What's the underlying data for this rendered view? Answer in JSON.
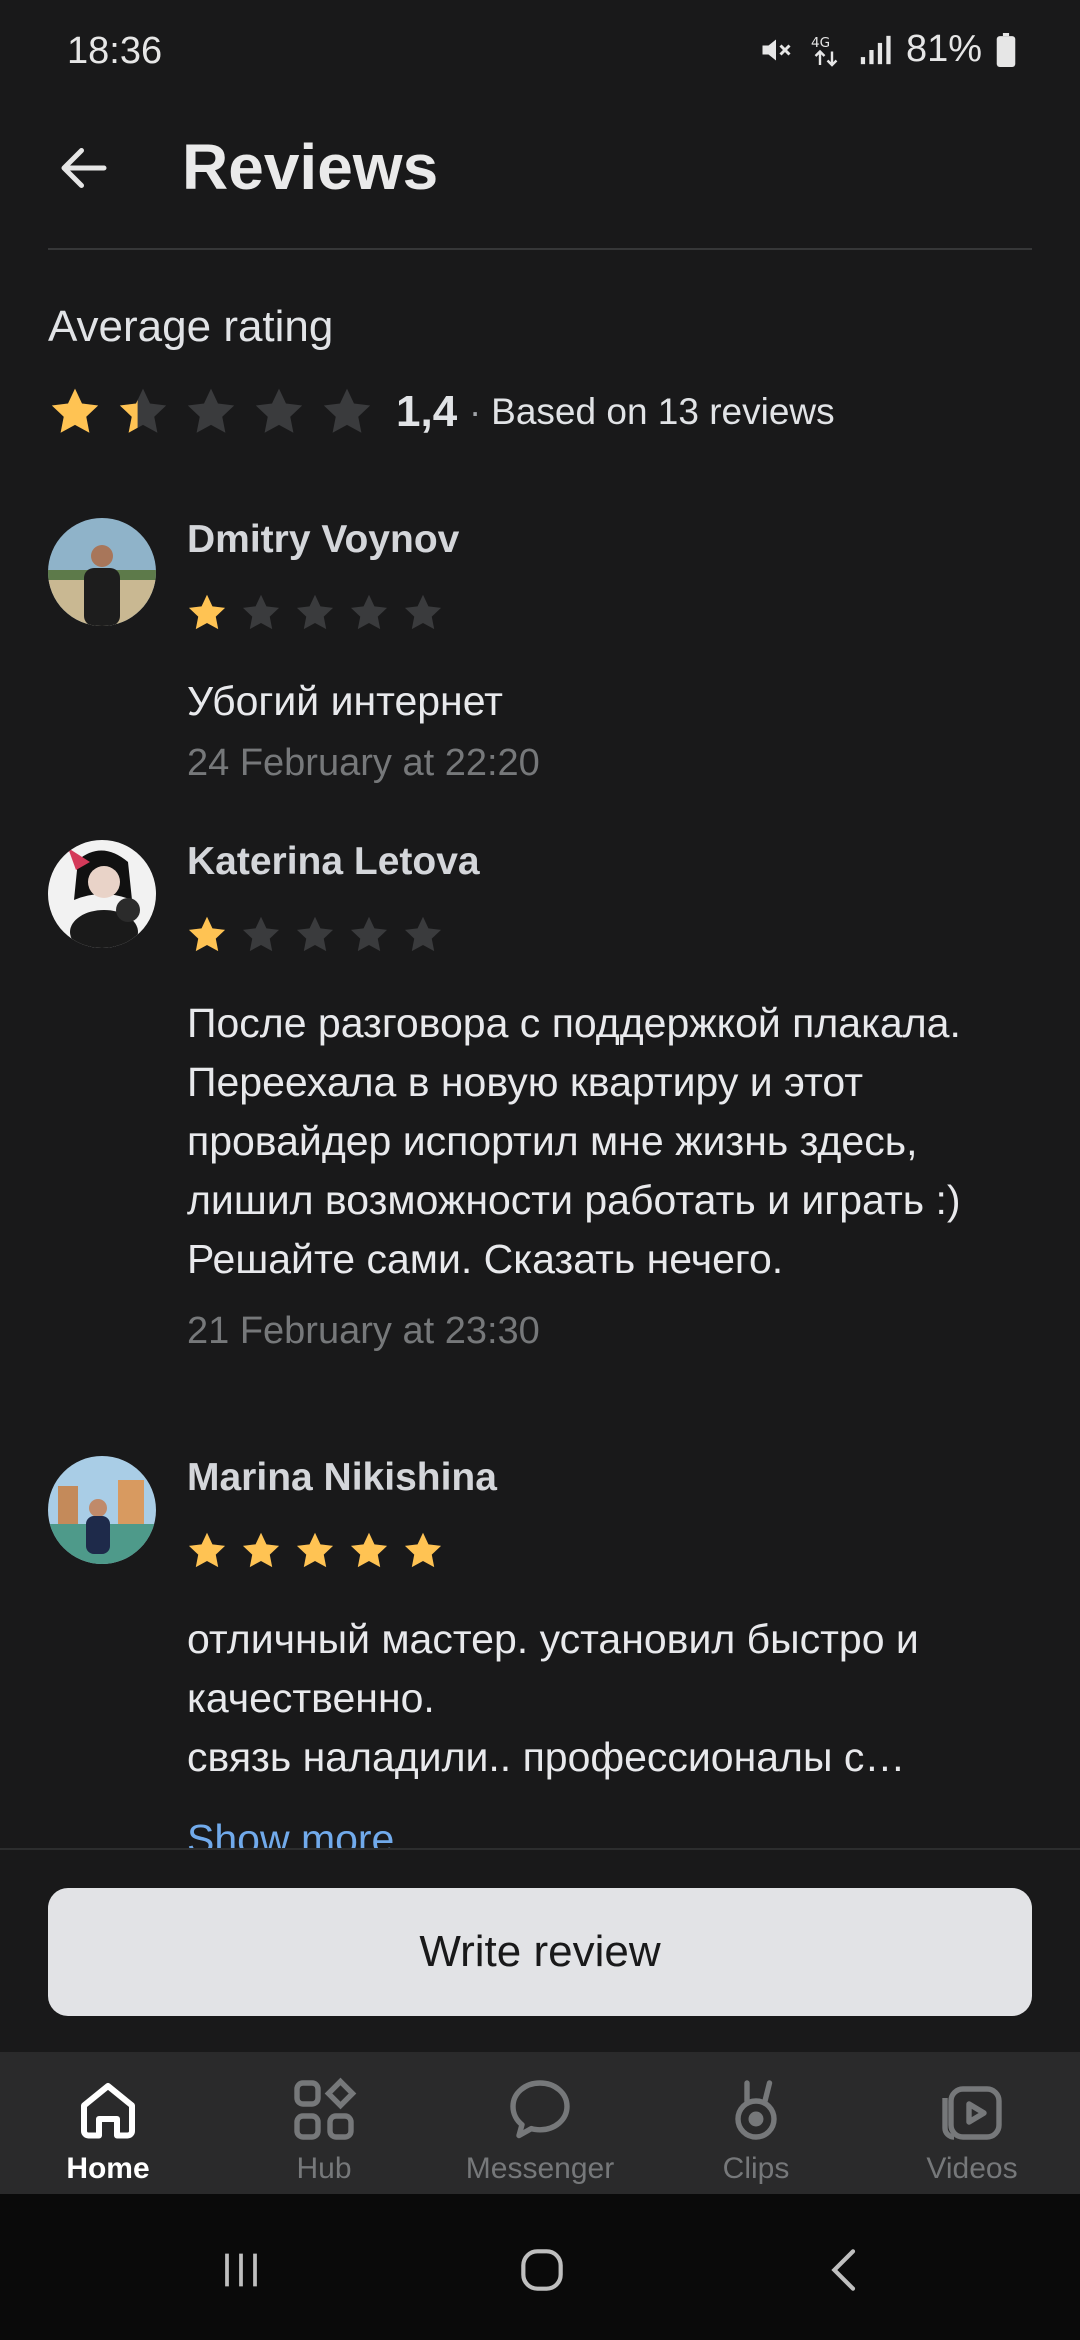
{
  "status_bar": {
    "time": "18:36",
    "battery": "81%"
  },
  "header": {
    "title": "Reviews"
  },
  "summary": {
    "label": "Average rating",
    "rating": 1.4,
    "rating_display": "1,4",
    "separator": "·",
    "based_on": "Based on 13 reviews"
  },
  "reviews": [
    {
      "name": "Dmitry Voynov",
      "stars": 1,
      "text": "Убогий интернет",
      "date": "24 February at 22:20"
    },
    {
      "name": "Katerina Letova",
      "stars": 1,
      "text": "После разговора с поддержкой плакала. Переехала в новую квартиру и этот провайдер испортил мне жизнь здесь, лишил возможности работать и играть :) Решайте сами. Сказать нечего.",
      "date": "21 February at 23:30"
    },
    {
      "name": "Marina Nikishina",
      "stars": 5,
      "text": "отличный мастер. установил быстро и качественно.\nсвязь наладили.. профессионалы с…",
      "show_more": "Show more"
    }
  ],
  "write_review_label": "Write review",
  "tabs": [
    {
      "label": "Home",
      "icon": "home-icon",
      "active": true
    },
    {
      "label": "Hub",
      "icon": "hub-icon"
    },
    {
      "label": "Messenger",
      "icon": "messenger-icon"
    },
    {
      "label": "Clips",
      "icon": "clips-icon"
    },
    {
      "label": "Videos",
      "icon": "videos-icon"
    }
  ],
  "colors": {
    "star_filled": "#ffc353",
    "star_empty": "#3a3b3d",
    "background": "#19191a",
    "link": "#71aaeb"
  }
}
